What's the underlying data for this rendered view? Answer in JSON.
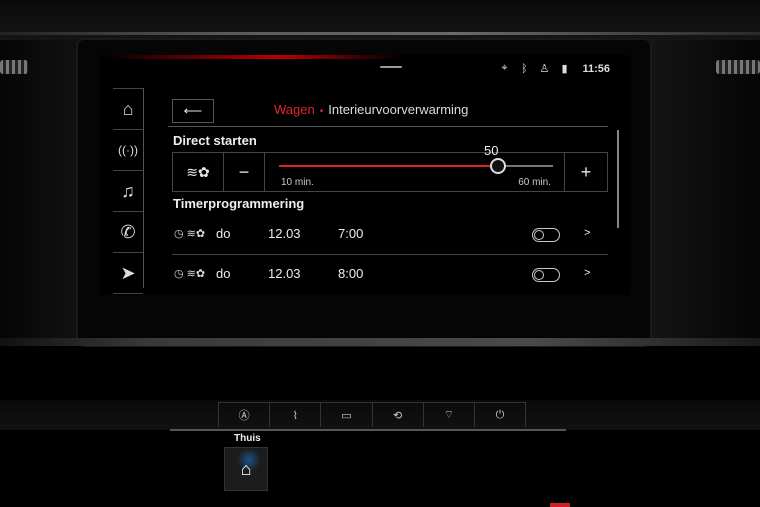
{
  "status": {
    "icons": [
      "nav-pin-icon",
      "bluetooth-icon",
      "user-icon",
      "signal-icon"
    ],
    "clock": "11:56"
  },
  "rail": {
    "items": [
      "home-icon",
      "radio-icon",
      "music-icon",
      "phone-icon",
      "navigation-icon"
    ]
  },
  "header": {
    "back_icon": "back-arrow-icon",
    "crumb_parent": "Wagen",
    "crumb_separator": "•",
    "crumb_current": "Interieurvoorverwarming"
  },
  "direct_start": {
    "title": "Direct starten",
    "minus": "−",
    "plus": "+",
    "value": "50",
    "value_num": 50,
    "min_num": 10,
    "max_num": 60,
    "min_label": "10 min.",
    "max_label": "60 min."
  },
  "timers": {
    "title": "Timerprogrammering",
    "rows": [
      {
        "day": "do",
        "date": "12.03",
        "time": "7:00",
        "enabled": false
      },
      {
        "day": "do",
        "date": "12.03",
        "time": "8:00",
        "enabled": false
      }
    ]
  },
  "console": {
    "buttons": [
      "auto-off-icon",
      "seat-heat-icon",
      "rear-defrost-icon",
      "recirculation-icon",
      "windscreen-off-icon",
      "power-icon"
    ],
    "home_label": "Thuis",
    "home_icon": "home-icon"
  }
}
